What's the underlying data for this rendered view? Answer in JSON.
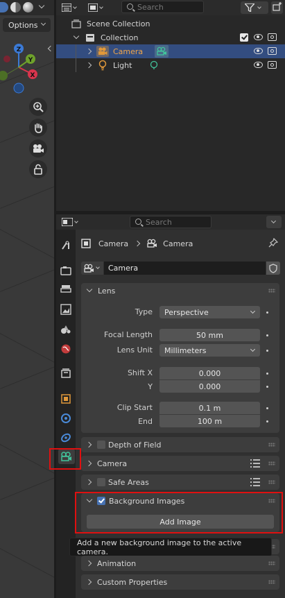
{
  "viewport": {
    "options_label": "Options",
    "axes": {
      "z": "Z",
      "y": "Y",
      "x": "X"
    }
  },
  "outliner": {
    "search_placeholder": "Search",
    "scene_collection_label": "Scene Collection",
    "collection_label": "Collection",
    "items": [
      {
        "label": "Camera",
        "selected": true
      },
      {
        "label": "Light",
        "selected": false
      }
    ]
  },
  "properties": {
    "search_placeholder": "Search",
    "breadcrumb": {
      "object": "Camera",
      "data": "Camera"
    },
    "datablock_name": "Camera",
    "lens_panel": {
      "title": "Lens",
      "type_label": "Type",
      "type_value": "Perspective",
      "focal_length_label": "Focal Length",
      "focal_length_value": "50 mm",
      "lens_unit_label": "Lens Unit",
      "lens_unit_value": "Millimeters",
      "shift_x_label": "Shift X",
      "shift_x_value": "0.000",
      "shift_y_label": "Y",
      "shift_y_value": "0.000",
      "clip_start_label": "Clip Start",
      "clip_start_value": "0.1 m",
      "clip_end_label": "End",
      "clip_end_value": "100 m"
    },
    "panels": {
      "depth_of_field": "Depth of Field",
      "camera": "Camera",
      "safe_areas": "Safe Areas",
      "background_images": "Background Images",
      "animation": "Animation",
      "custom_properties": "Custom Properties"
    },
    "add_image_label": "Add Image",
    "tooltip": "Add a new background image to the active camera."
  },
  "colors": {
    "accent_blue": "#4772b3",
    "selection_row": "#334d80",
    "camera_orange": "#e0983a",
    "data_green": "#42c49c",
    "highlight_red": "#e01010"
  }
}
